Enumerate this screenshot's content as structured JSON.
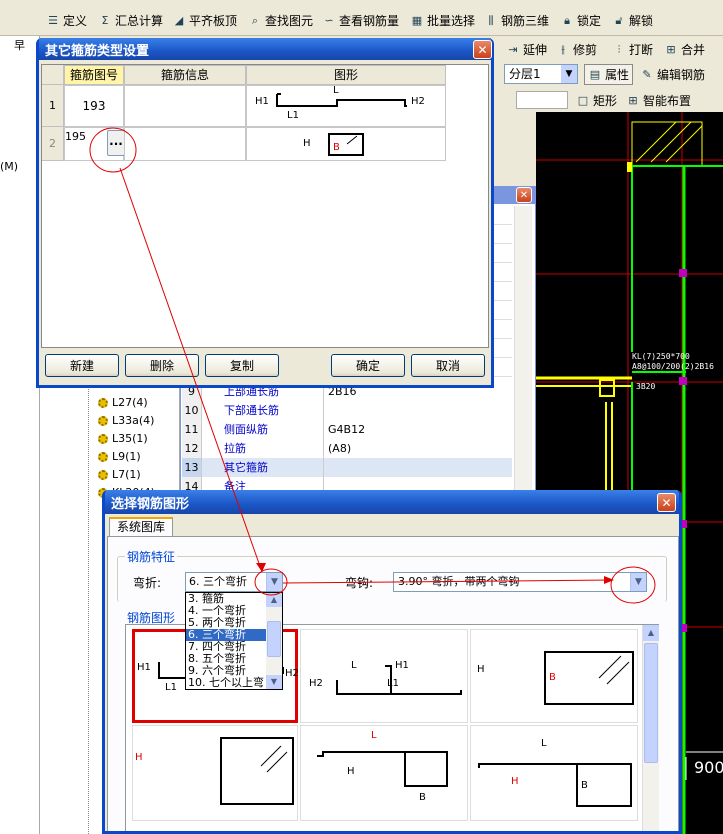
{
  "toolbar": {
    "define": "定义",
    "sum_calc": "汇总计算",
    "align_slab": "平齐板顶",
    "find_element": "查找图元",
    "view_rebar_qty": "查看钢筋量",
    "batch_select": "批量选择",
    "rebar_3d": "钢筋三维",
    "lock": "锁定",
    "unlock": "解锁",
    "extend": "延伸",
    "trim": "修剪",
    "break": "打断",
    "merge": "合并",
    "floor": "分层1",
    "properties": "属性",
    "edit_rebar": "编辑钢筋",
    "rect": "矩形",
    "smart_place": "智能布置",
    "pin_label": "早",
    "left_fragment": "(M)"
  },
  "stirrup_dialog": {
    "title": "其它箍筋类型设置",
    "columns": [
      "箍筋图号",
      "箍筋信息",
      "图形"
    ],
    "rows": [
      {
        "num": "1",
        "code": "193",
        "info": ""
      },
      {
        "num": "2",
        "code": "195",
        "info": ""
      }
    ],
    "shape1": {
      "h1": "H1",
      "l": "L",
      "l1": "L1",
      "h2": "H2"
    },
    "shape2": {
      "h": "H",
      "b": "B"
    },
    "ellipsis": "...",
    "buttons": {
      "new": "新建",
      "delete": "删除",
      "copy": "复制",
      "ok": "确定",
      "cancel": "取消"
    }
  },
  "tree": {
    "items": [
      "L27(4)",
      "L33a(4)",
      "L35(1)",
      "L9(1)",
      "L7(1)",
      "KL20(4)"
    ]
  },
  "props": {
    "rows": [
      {
        "n": "9",
        "k": "上部通长筋",
        "v": "2B16"
      },
      {
        "n": "10",
        "k": "下部通长筋",
        "v": ""
      },
      {
        "n": "11",
        "k": "侧面纵筋",
        "v": "G4B12"
      },
      {
        "n": "12",
        "k": "拉筋",
        "v": "(A8)"
      },
      {
        "n": "13",
        "k": "其它箍筋",
        "v": ""
      },
      {
        "n": "14",
        "k": "备注",
        "v": ""
      }
    ]
  },
  "cad": {
    "beam_label_1": "KL(7)250*700",
    "beam_label_2": "A8@100/200(2)2B16",
    "beam_label_3": "3B20",
    "dim": "900"
  },
  "shape_dialog": {
    "title": "选择钢筋图形",
    "tab": "系统图库",
    "group_feature": "钢筋特征",
    "bend_label": "弯折:",
    "bend_value": "6. 三个弯折",
    "hook_label": "弯钩:",
    "hook_value": "3.90° 弯折，带两个弯钩",
    "bend_options": [
      "3. 箍筋",
      "4. 一个弯折",
      "5. 两个弯折",
      "6. 三个弯折",
      "7. 四个弯折",
      "8. 五个弯折",
      "9. 六个弯折",
      "10. 七个以上弯"
    ],
    "bend_selected_index": 3,
    "group_shapes": "钢筋图形",
    "shape_labels": {
      "h1": "H1",
      "h2": "H2",
      "l": "L",
      "l1": "L1",
      "h": "H",
      "b": "B"
    }
  },
  "colors": {
    "xp_title": "#1b56c7",
    "annotation_red": "#e00000",
    "selected_blue": "#316ac5",
    "cad_bg": "#000000"
  }
}
